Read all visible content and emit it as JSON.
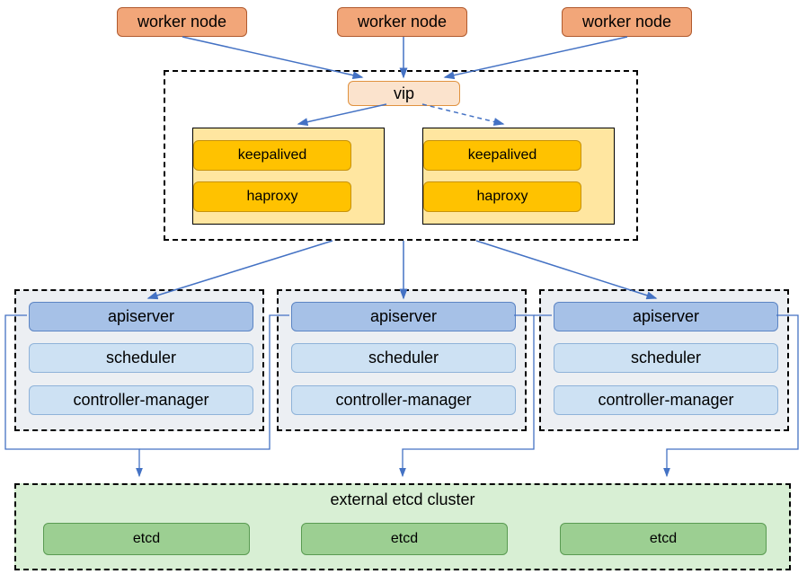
{
  "workers": [
    "worker node",
    "worker node",
    "worker node"
  ],
  "vip": "vip",
  "lb": {
    "keepalived": "keepalived",
    "haproxy": "haproxy"
  },
  "cp": {
    "apiserver": "apiserver",
    "scheduler": "scheduler",
    "controller": "controller-manager"
  },
  "etcd": {
    "title": "external etcd cluster",
    "node": "etcd"
  }
}
